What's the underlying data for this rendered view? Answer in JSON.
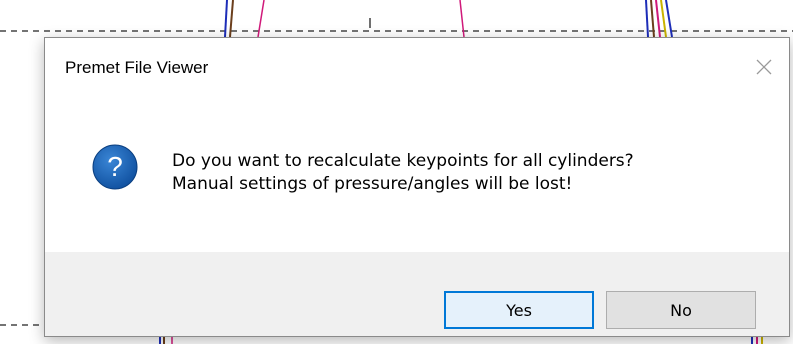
{
  "dialog": {
    "title": "Premet File Viewer",
    "close_icon": "close-icon",
    "question_icon": "question-icon",
    "message_line1": "Do you want to recalculate keypoints for all cylinders?",
    "message_line2": "Manual settings of pressure/angles will be lost!",
    "buttons": {
      "yes_label": "Yes",
      "no_label": "No"
    },
    "default_button": "Yes",
    "colors": {
      "accent": "#0078d7",
      "icon_blue": "#1a5fb4",
      "footer_bg": "#f0f0f0"
    }
  }
}
